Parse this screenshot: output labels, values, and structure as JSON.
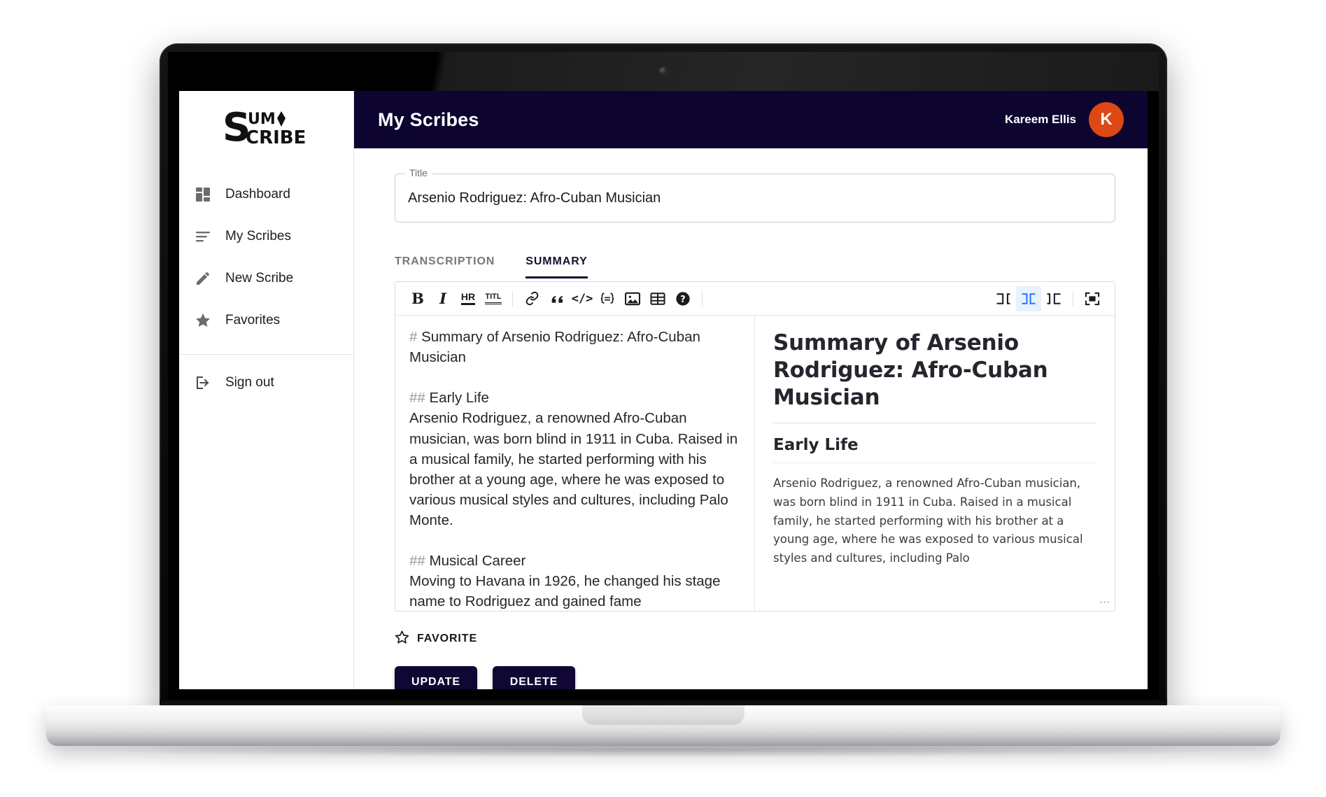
{
  "brand": {
    "logo_top": "UM",
    "logo_bottom": "CRIBE",
    "logo_s": "S",
    "name": "SumScribe"
  },
  "sidebar": {
    "items": [
      {
        "label": "Dashboard",
        "icon": "dashboard-grid-icon"
      },
      {
        "label": "My Scribes",
        "icon": "list-lines-icon"
      },
      {
        "label": "New Scribe",
        "icon": "pencil-icon"
      },
      {
        "label": "Favorites",
        "icon": "star-filled-icon"
      }
    ],
    "signout": {
      "label": "Sign out",
      "icon": "logout-icon"
    }
  },
  "header": {
    "title": "My Scribes",
    "user_name": "Kareem Ellis",
    "avatar_initial": "K",
    "avatar_color": "#dd4814",
    "bar_color": "#0d0430"
  },
  "title_field": {
    "legend": "Title",
    "value": "Arsenio Rodriguez: Afro-Cuban Musician"
  },
  "tabs": [
    {
      "label": "TRANSCRIPTION",
      "active": false
    },
    {
      "label": "SUMMARY",
      "active": true
    }
  ],
  "toolbar": {
    "left": [
      {
        "name": "bold-button",
        "glyph": "B"
      },
      {
        "name": "italic-button",
        "glyph": "I"
      },
      {
        "name": "horizontal-rule-button",
        "glyph": "HR"
      },
      {
        "name": "title-button",
        "glyph": "TITL"
      },
      {
        "name": "link-button",
        "glyph": "link-icon"
      },
      {
        "name": "quote-button",
        "glyph": "quote-icon"
      },
      {
        "name": "inline-code-button",
        "glyph": "code-icon"
      },
      {
        "name": "code-block-button",
        "glyph": "code-block-icon"
      },
      {
        "name": "image-button",
        "glyph": "image-icon"
      },
      {
        "name": "table-button",
        "glyph": "table-icon"
      },
      {
        "name": "help-button",
        "glyph": "help-icon"
      }
    ],
    "right": [
      {
        "name": "view-edit-only-button",
        "active": false
      },
      {
        "name": "view-split-button",
        "active": true
      },
      {
        "name": "view-preview-only-button",
        "active": false
      },
      {
        "name": "fullscreen-button",
        "active": false
      }
    ],
    "active_accent": "#2176ff"
  },
  "editor": {
    "markdown_blocks": [
      {
        "hash": "#",
        "text": " Summary of Arsenio Rodriguez: Afro-Cuban Musician"
      },
      {
        "hash": "",
        "text": ""
      },
      {
        "hash": "##",
        "text": " Early Life"
      },
      {
        "hash": "",
        "text": "Arsenio Rodriguez, a renowned Afro-Cuban musician, was born blind in 1911 in Cuba. Raised in a musical family, he started performing with his brother at a young age, where he was exposed to various musical styles and cultures, including Palo Monte."
      },
      {
        "hash": "",
        "text": ""
      },
      {
        "hash": "##",
        "text": " Musical Career"
      },
      {
        "hash": "",
        "text": "Moving to Havana in 1926, he changed his stage name to Rodriguez and gained fame"
      }
    ]
  },
  "preview": {
    "h1": "Summary of Arsenio Rodriguez: Afro-Cuban Musician",
    "h2": "Early Life",
    "paragraph": "Arsenio Rodriguez, a renowned Afro-Cuban musician, was born blind in 1911 in Cuba. Raised in a musical family, he started performing with his brother at a young age, where he was exposed to various musical styles and cultures, including Palo",
    "resize_grip": "⋯"
  },
  "actions": {
    "favorite_label": "FAVORITE",
    "update_label": "UPDATE",
    "delete_label": "DELETE",
    "button_color": "#100734"
  }
}
